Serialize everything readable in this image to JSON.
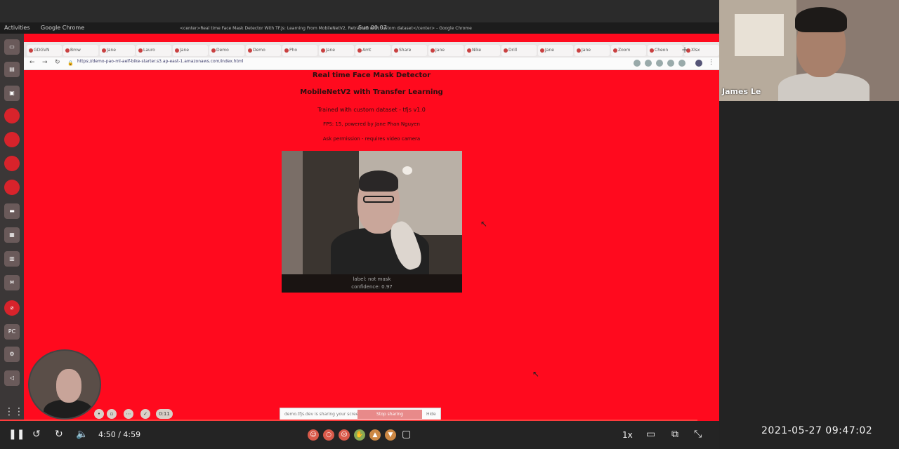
{
  "os_topbar": {
    "activities": "Activities",
    "app_menu": "Google Chrome",
    "clock": "Sun 00:07",
    "window_title": "<center>Real time Face Mask Detector With TF.js: Learning From MobileNetV2, Retrained with custom dataset</center> - Google Chrome"
  },
  "dock": {
    "apps": [
      "files",
      "terminal",
      "browser",
      "chrome",
      "git",
      "settings",
      "text",
      "calc",
      "mail",
      "code",
      "pycharm",
      "firefox",
      "vscode"
    ],
    "apps_grid_icon": "grid-icon"
  },
  "browser": {
    "tabs": [
      "GDGVN",
      "Bmw",
      "Jane",
      "Lauro",
      "Jane",
      "Demo",
      "Demo",
      "Pho",
      "Jane",
      "Amt",
      "Share",
      "Jane",
      "Nike",
      "Drill",
      "Jane",
      "Jane",
      "Zoom",
      "Cheon",
      "Xlsx"
    ],
    "new_tab": "+",
    "url": "https://demo-pao-ml-aelf-bike-starter.s3.ap-east-1.amazonaws.com/index.html"
  },
  "page": {
    "heading1": "Real time Face Mask Detector",
    "heading2": "MobileNetV2 with Transfer Learning",
    "line3": "Trained with custom dataset - tfjs v1.0",
    "line4": "FPS: 15, powered by Jane Phan Nguyen",
    "line5": "Ask permission - requires video camera",
    "camera_caption_line1": "label: not mask",
    "camera_caption_line2": "confidence: 0.97",
    "share_notice": "demo.tfjs.dev is sharing your screen.",
    "stop_sharing": "Stop sharing",
    "hide": "Hide"
  },
  "self_view_controls": [
    "mic",
    "video",
    "more",
    "ok",
    "0:11"
  ],
  "participant": {
    "name": "James Le"
  },
  "player": {
    "time": "4:50 / 4:59",
    "speed": "1x",
    "reactions": [
      "laugh",
      "wow",
      "sad",
      "clap",
      "thumbs-up",
      "thumbs-down"
    ],
    "progress": 0.97
  },
  "timestamp": "2021-05-27  09:47:02"
}
